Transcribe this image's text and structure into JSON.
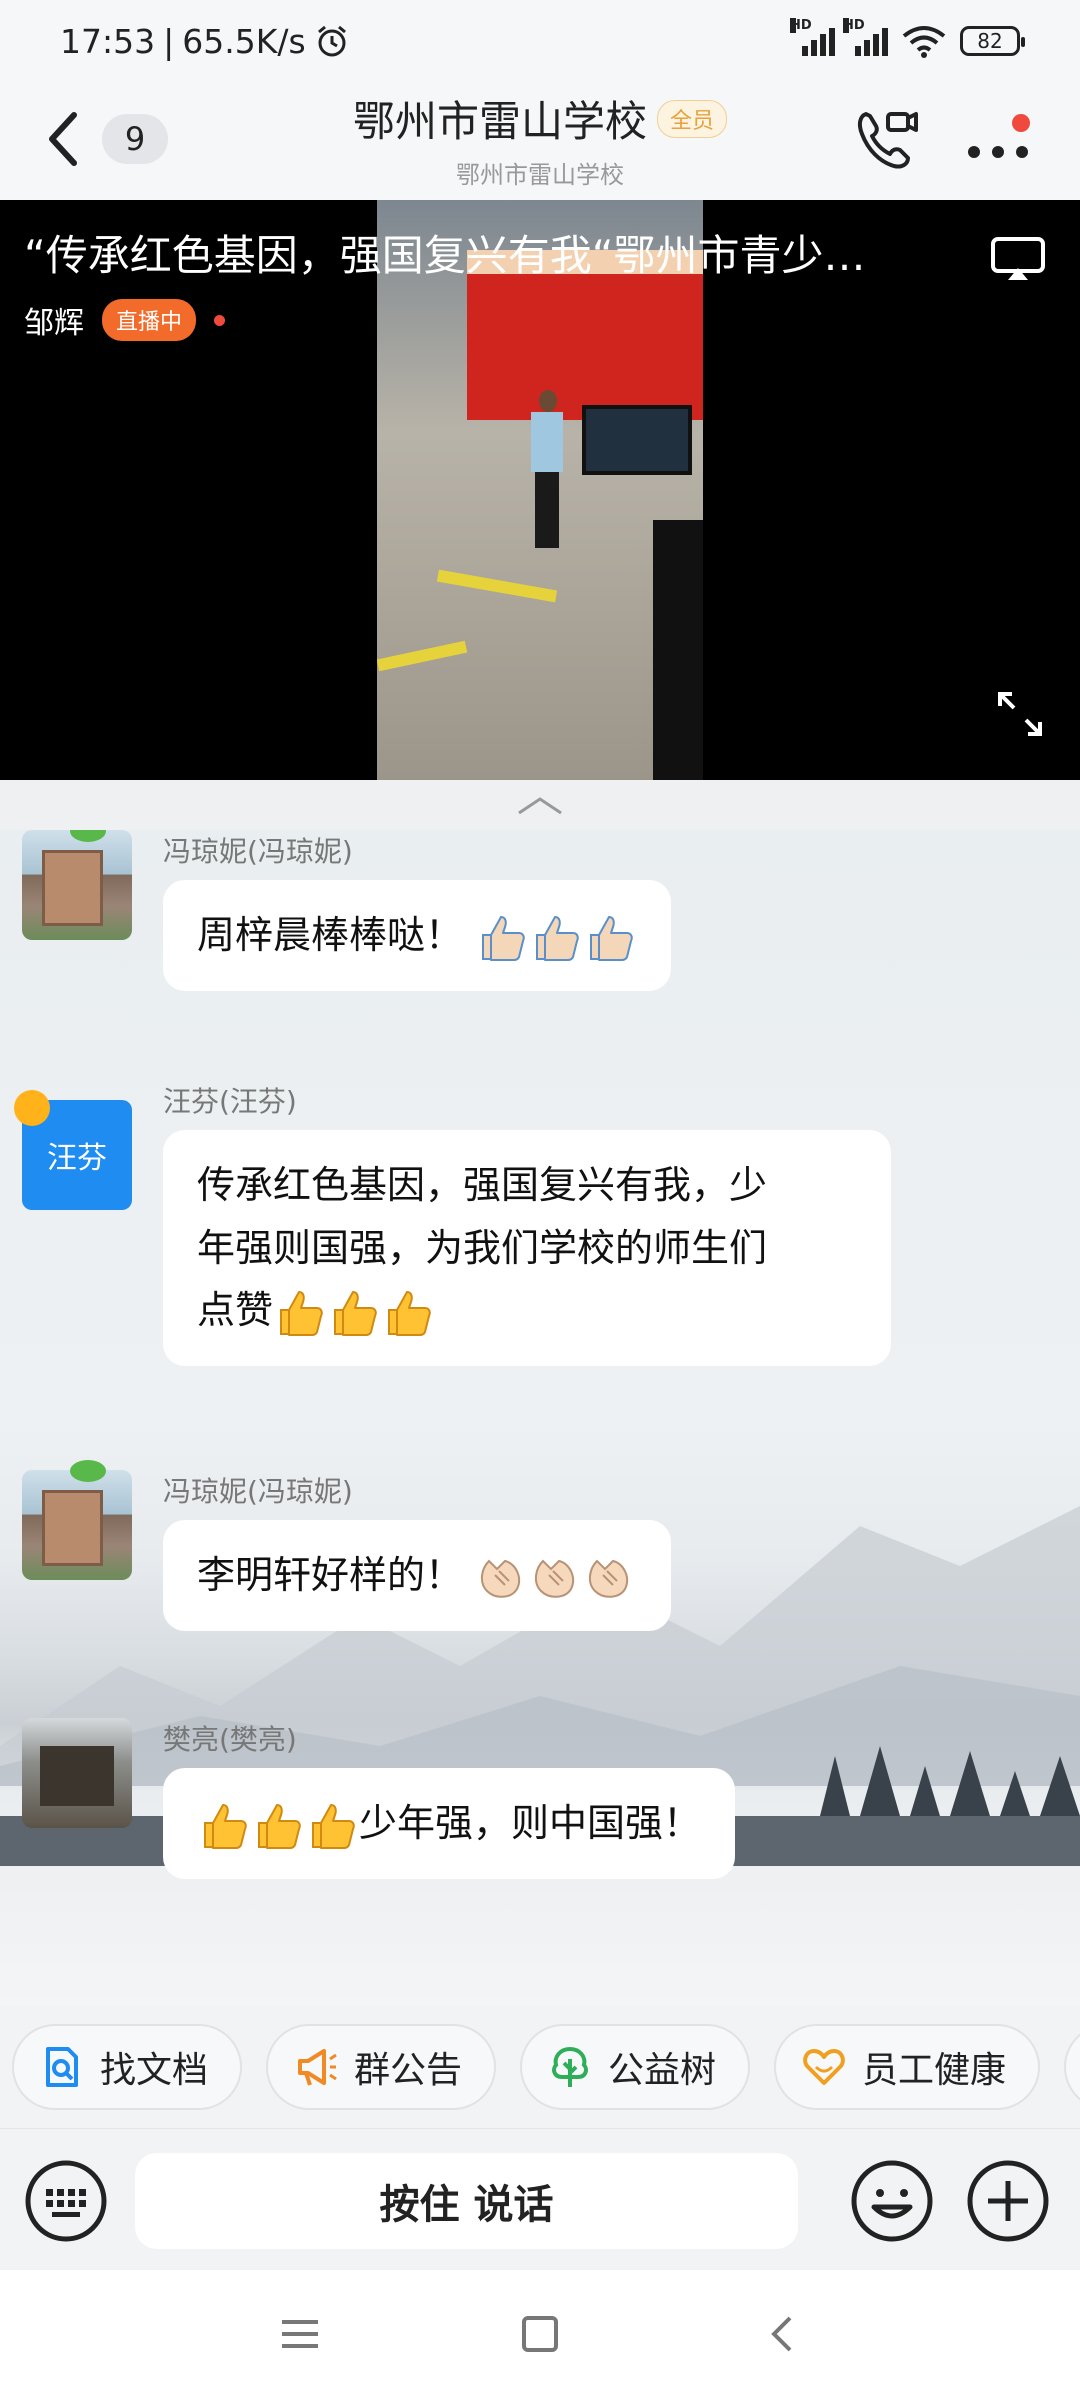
{
  "status_bar": {
    "time": "17:53",
    "separator": "|",
    "speed": "65.5K/s",
    "net_label": "HD",
    "battery": "82"
  },
  "header": {
    "unread_count": "9",
    "title": "鄂州市雷山学校",
    "member_tag": "全员",
    "subtitle": "鄂州市雷山学校"
  },
  "live": {
    "title": "“传承红色基因，强国复兴有我“鄂州市青少…",
    "host": "邹辉",
    "badge": "直播中"
  },
  "messages": [
    {
      "sender": "冯琼妮(冯琼妮)",
      "text": "周梓晨棒棒哒！",
      "emoji": "thumbs-up-light",
      "emoji_count": 3,
      "avatar": "school-photo"
    },
    {
      "sender": "汪芬(汪芬)",
      "line1": "传承红色基因，强国复兴有我，少",
      "line2": "年强则国强，为我们学校的师生们",
      "line3": "点赞",
      "emoji": "thumbs-up-yellow",
      "emoji_count": 3,
      "avatar_text": "汪芬"
    },
    {
      "sender": "冯琼妮(冯琼妮)",
      "text": "李明轩好样的！",
      "emoji": "clapping-hands",
      "emoji_count": 3,
      "avatar": "school-photo"
    },
    {
      "sender": "樊亮(樊亮)",
      "text": "少年强，则中国强！",
      "emoji": "thumbs-up-yellow",
      "emoji_count": 3,
      "avatar": "palace-model"
    }
  ],
  "shortcuts": [
    {
      "label": "找文档",
      "icon": "doc-search-icon",
      "color": "#1e8cf0"
    },
    {
      "label": "群公告",
      "icon": "megaphone-icon",
      "color": "#f08a24"
    },
    {
      "label": "公益树",
      "icon": "tree-icon",
      "color": "#2fae5a"
    },
    {
      "label": "员工健康",
      "icon": "heart-icon",
      "color": "#f0a020"
    }
  ],
  "input": {
    "hold_to_talk": "按住 说话"
  },
  "colors": {
    "accent": "#1e8cf0",
    "live_badge": "#f26b2b",
    "member_tag": "#e6a23c",
    "notify_dot": "#f04a3e"
  }
}
